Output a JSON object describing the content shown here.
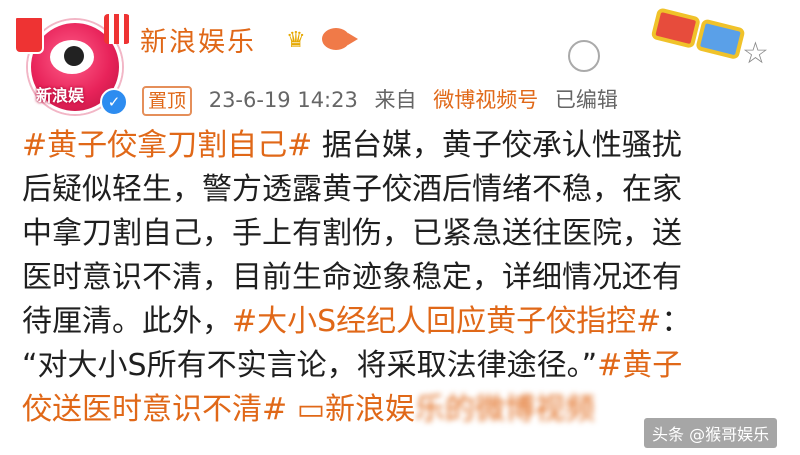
{
  "account": {
    "name": "新浪娱乐",
    "avatar_text": "新浪娱",
    "verified_icon": "check-icon"
  },
  "meta": {
    "pinned_label": "置顶",
    "datetime": "23-6-19 14:23",
    "from_label": "来自",
    "source": "微博视频号",
    "edited_label": "已编辑"
  },
  "post": {
    "line1_tag": "#黄子佼拿刀割自己#",
    "line1_text": " 据台媒，黄子佼承认性骚扰",
    "line2": "后疑似轻生，警方透露黄子佼酒后情绪不稳，在家",
    "line3": "中拿刀割自己，手上有割伤，已紧急送往医院，送",
    "line4": "医时意识不清，目前生命迹象稳定，详细情况还有",
    "line5_text": "待厘清。此外，",
    "line5_tag": "#大小S经纪人回应黄子佼指控#",
    "line5_end": "：",
    "line6_text": "“对大小S所有不实言论，将采取法律途径。”",
    "line6_tag": "#黄子",
    "line7_tag": "佼送医时意识不清#",
    "line7_link_icon": "video-icon",
    "line7_link": "新浪娱",
    "line7_blurred": "乐的微博视频"
  },
  "watermark": {
    "text": "头条 @猴哥娱乐"
  },
  "colors": {
    "accent": "#e06818",
    "text": "#1f1f1f",
    "meta": "#666666"
  }
}
